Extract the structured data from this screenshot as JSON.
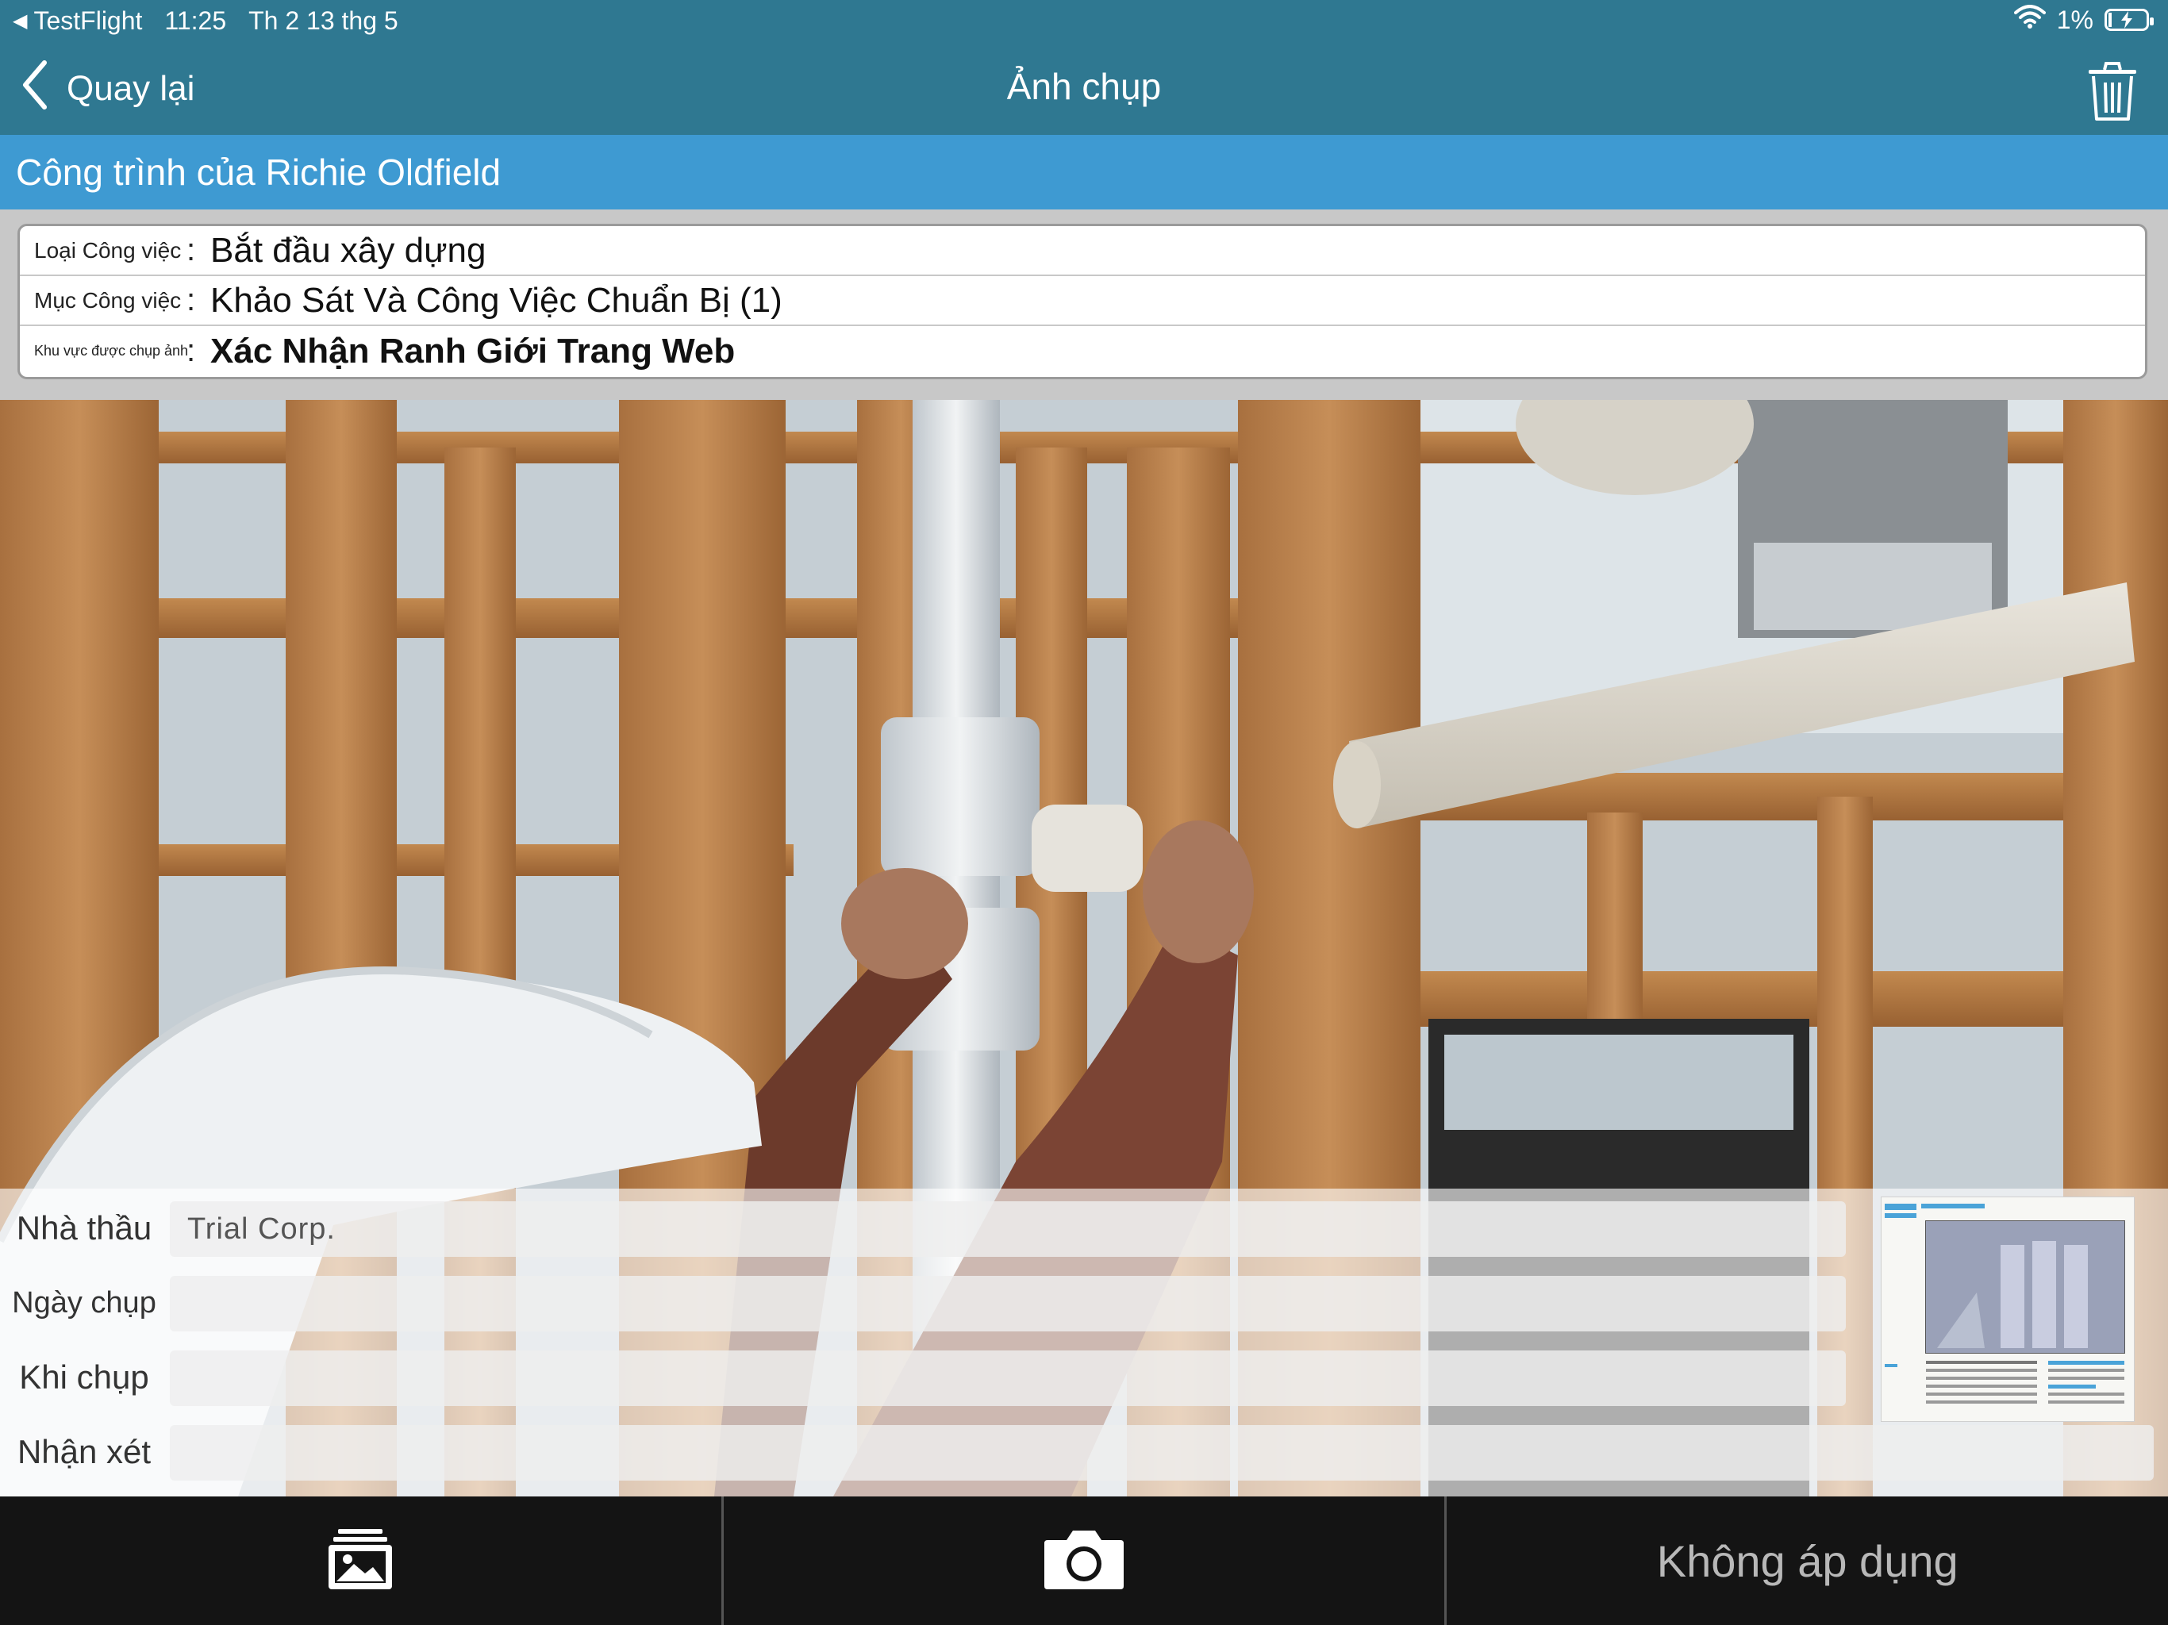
{
  "status_bar": {
    "back_app": "TestFlight",
    "time": "11:25",
    "date": "Th 2 13 thg 5",
    "battery_percent": "1%"
  },
  "nav": {
    "back_label": "Quay lại",
    "title": "Ảnh chụp"
  },
  "project": {
    "name": "Công trình của Richie Oldfield"
  },
  "info": {
    "work_type_label": "Loại Công việc",
    "work_type_value": "Bắt đầu xây dựng",
    "work_item_label": "Mục Công việc",
    "work_item_value": "Khảo Sát Và Công Việc Chuẩn Bị (1)",
    "area_label": "Khu vực được chụp ảnh",
    "area_value": "Xác Nhận Ranh Giới Trang Web",
    "colon": ":"
  },
  "meta": {
    "contractor_label": "Nhà thầu",
    "contractor_value": "Trial Corp.",
    "date_label": "Ngày chụp",
    "date_value": "",
    "when_label": "Khi chụp",
    "when_value": "",
    "comment_label": "Nhận xét",
    "comment_value": ""
  },
  "toolbar": {
    "not_apply_label": "Không áp dụng"
  },
  "icons": {
    "back": "chevron-left-icon",
    "trash": "trash-icon",
    "gallery": "gallery-icon",
    "camera": "camera-icon",
    "wifi": "wifi-icon",
    "battery": "battery-charging-icon"
  },
  "colors": {
    "nav_bg": "#2f7891",
    "banner_bg": "#3e9ad2",
    "toolbar_bg": "#141414"
  }
}
